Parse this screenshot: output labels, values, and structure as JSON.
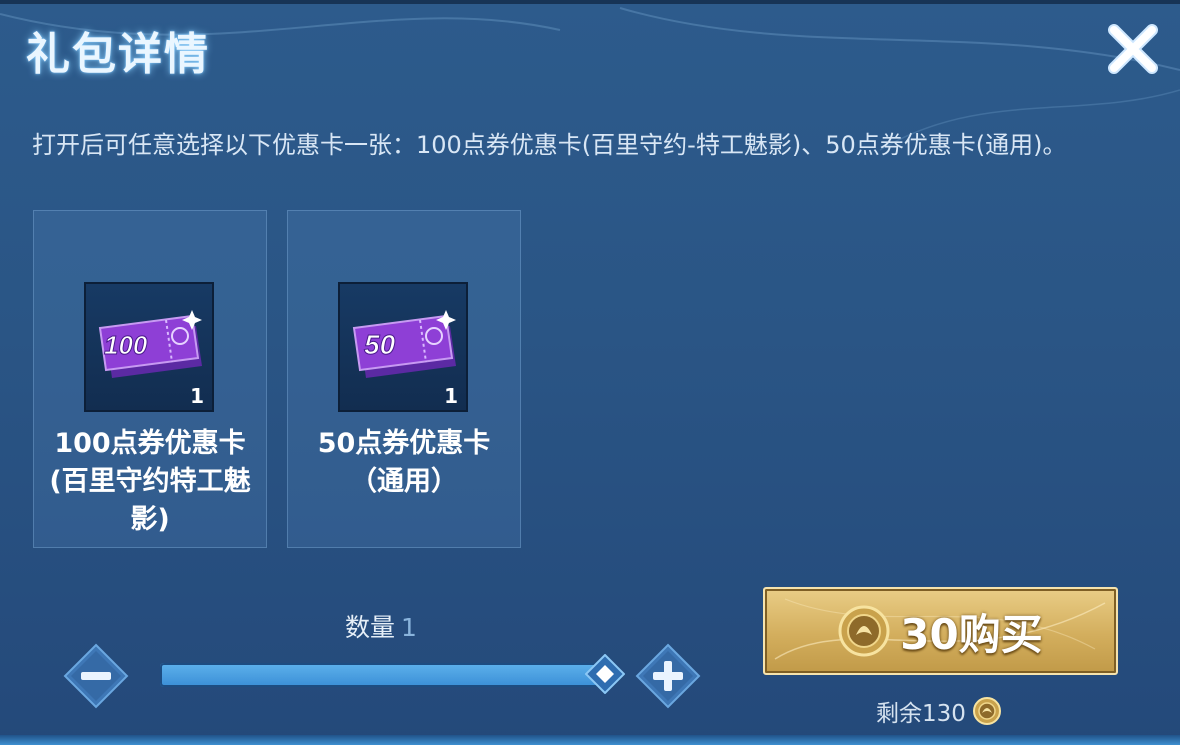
{
  "dialog": {
    "title": "礼包详情",
    "description": "打开后可任意选择以下优惠卡一张：100点券优惠卡(百里守约-特工魅影)、50点券优惠卡(通用)。"
  },
  "items": [
    {
      "ticket_value": "100",
      "count": "1",
      "name": "100点券优惠卡(百里守约特工魅影)",
      "icon": "purple-voucher-ticket-icon"
    },
    {
      "ticket_value": "50",
      "count": "1",
      "name": "50点券优惠卡（通用）",
      "icon": "purple-voucher-ticket-icon"
    }
  ],
  "quantity": {
    "label": "数量",
    "value": "1",
    "slider_level": 1.0
  },
  "purchase": {
    "price": "30",
    "label": "购买",
    "remaining_label": "剩余130",
    "currency_icon": "gold-coin-icon"
  },
  "colors": {
    "panel_bg": "#2a5585",
    "button_gold": "#d3ae5d",
    "ticket_purple": "#8e3fd6",
    "slider_blue": "#4a9fe0"
  }
}
